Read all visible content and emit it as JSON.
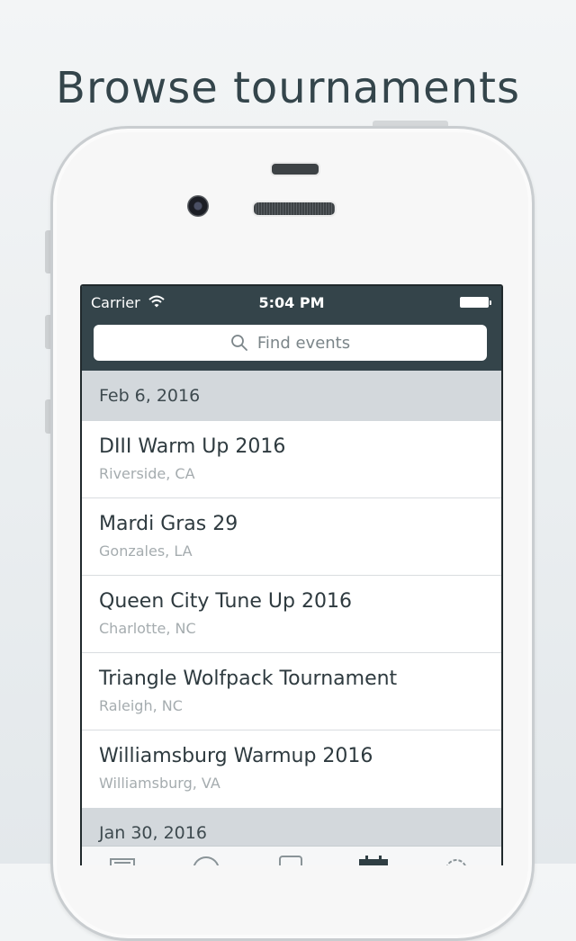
{
  "headline": "Browse tournaments",
  "status_bar": {
    "carrier": "Carrier",
    "time": "5:04 PM"
  },
  "search": {
    "placeholder": "Find events"
  },
  "sections": [
    {
      "date": "Feb 6, 2016",
      "events": [
        {
          "title": "DIII Warm Up 2016",
          "location": "Riverside, CA"
        },
        {
          "title": "Mardi Gras 29",
          "location": "Gonzales, LA"
        },
        {
          "title": "Queen City Tune Up 2016",
          "location": "Charlotte, NC"
        },
        {
          "title": "Triangle Wolfpack Tournament",
          "location": "Raleigh, NC"
        },
        {
          "title": "Williamsburg Warmup 2016",
          "location": "Williamsburg, VA"
        }
      ]
    },
    {
      "date": "Jan 30, 2016",
      "events": []
    }
  ],
  "tab_icons": [
    "news-icon",
    "circle-icon",
    "square-icon",
    "calendar-icon",
    "gear-icon"
  ],
  "colors": {
    "navbar": "#34444a",
    "section_header": "#d3d8dc",
    "headline": "#34454b"
  }
}
